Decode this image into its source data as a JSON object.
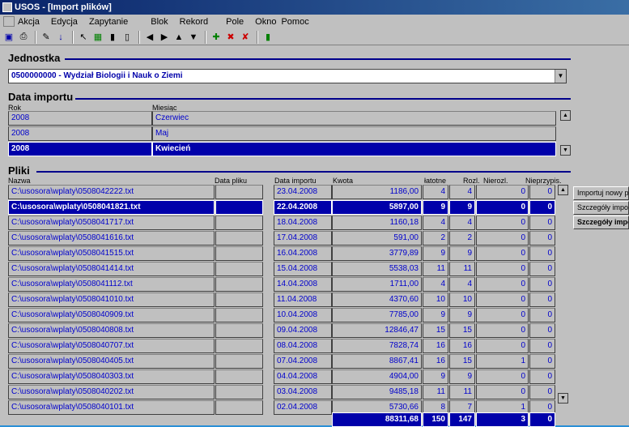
{
  "window": {
    "title": "USOS - [Import plików]"
  },
  "menu": [
    "Akcja",
    "Edycja",
    "Zapytanie",
    "Blok",
    "Rekord",
    "Pole",
    "Okno",
    "Pomoc"
  ],
  "toolbar": [
    {
      "name": "save-icon",
      "glyph": "▣",
      "color": "#0000aa"
    },
    {
      "name": "print-icon",
      "glyph": "⎙",
      "color": "#000000"
    },
    {
      "name": "edit-icon",
      "glyph": "✎",
      "color": "#000000"
    },
    {
      "name": "sort-down-icon",
      "glyph": "↓",
      "color": "#0000aa"
    },
    {
      "name": "query-icon",
      "glyph": "↖",
      "color": "#000000"
    },
    {
      "name": "query-execute-icon",
      "glyph": "▦",
      "color": "#008000"
    },
    {
      "name": "chart-icon",
      "glyph": "▮",
      "color": "#000000"
    },
    {
      "name": "chart-alt-icon",
      "glyph": "▯",
      "color": "#000000"
    },
    {
      "name": "prev-record-icon",
      "glyph": "◀",
      "color": "#000000"
    },
    {
      "name": "next-record-icon",
      "glyph": "▶",
      "color": "#000000"
    },
    {
      "name": "prev-block-icon",
      "glyph": "▲",
      "color": "#000000"
    },
    {
      "name": "next-block-icon",
      "glyph": "▼",
      "color": "#000000"
    },
    {
      "name": "insert-record-icon",
      "glyph": "✚",
      "color": "#008000"
    },
    {
      "name": "delete-record-icon",
      "glyph": "✖",
      "color": "#cc0000"
    },
    {
      "name": "clear-record-icon",
      "glyph": "✘",
      "color": "#cc0000"
    },
    {
      "name": "exit-icon",
      "glyph": "▮",
      "color": "#008000"
    }
  ],
  "jednostka": {
    "title": "Jednostka",
    "value": "0500000000 - Wydział Biologii i Nauk o Ziemi"
  },
  "data_importu": {
    "title": "Data importu",
    "col_rok": "Rok",
    "col_miesiac": "Miesiąc",
    "rows": [
      {
        "rok": "2008",
        "miesiac": "Czerwiec",
        "selected": false
      },
      {
        "rok": "2008",
        "miesiac": "Maj",
        "selected": false
      },
      {
        "rok": "2008",
        "miesiac": "Kwiecień",
        "selected": true
      }
    ]
  },
  "pliki": {
    "title": "Pliki",
    "headers": {
      "nazwa": "Nazwa",
      "data_pliku": "Data pliku",
      "data_importu": "Data importu",
      "kwota": "Kwota",
      "platne": "łatotne",
      "rozl": "Rozl.",
      "nierozl": "Nierozl.",
      "nieprzypis": "Nieprzypis."
    },
    "rows": [
      {
        "nazwa": "C:\\usosora\\wplaty\\0508042222.txt",
        "data_pliku": "",
        "data_importu": "23.04.2008",
        "kwota": "1186,00",
        "platne": "4",
        "rozl": "4",
        "nierozl": "0",
        "nieprzypis": "0",
        "selected": false
      },
      {
        "nazwa": "C:\\usosora\\wplaty\\0508041821.txt",
        "data_pliku": "",
        "data_importu": "22.04.2008",
        "kwota": "5897,00",
        "platne": "9",
        "rozl": "9",
        "nierozl": "0",
        "nieprzypis": "0",
        "selected": true
      },
      {
        "nazwa": "C:\\usosora\\wplaty\\0508041717.txt",
        "data_pliku": "",
        "data_importu": "18.04.2008",
        "kwota": "1160,18",
        "platne": "4",
        "rozl": "4",
        "nierozl": "0",
        "nieprzypis": "0",
        "selected": false
      },
      {
        "nazwa": "C:\\usosora\\wplaty\\0508041616.txt",
        "data_pliku": "",
        "data_importu": "17.04.2008",
        "kwota": "591,00",
        "platne": "2",
        "rozl": "2",
        "nierozl": "0",
        "nieprzypis": "0",
        "selected": false
      },
      {
        "nazwa": "C:\\usosora\\wplaty\\0508041515.txt",
        "data_pliku": "",
        "data_importu": "16.04.2008",
        "kwota": "3779,89",
        "platne": "9",
        "rozl": "9",
        "nierozl": "0",
        "nieprzypis": "0",
        "selected": false
      },
      {
        "nazwa": "C:\\usosora\\wplaty\\0508041414.txt",
        "data_pliku": "",
        "data_importu": "15.04.2008",
        "kwota": "5538,03",
        "platne": "11",
        "rozl": "11",
        "nierozl": "0",
        "nieprzypis": "0",
        "selected": false
      },
      {
        "nazwa": "C:\\usosora\\wplaty\\0508041112.txt",
        "data_pliku": "",
        "data_importu": "14.04.2008",
        "kwota": "1711,00",
        "platne": "4",
        "rozl": "4",
        "nierozl": "0",
        "nieprzypis": "0",
        "selected": false
      },
      {
        "nazwa": "C:\\usosora\\wplaty\\0508041010.txt",
        "data_pliku": "",
        "data_importu": "11.04.2008",
        "kwota": "4370,60",
        "platne": "10",
        "rozl": "10",
        "nierozl": "0",
        "nieprzypis": "0",
        "selected": false
      },
      {
        "nazwa": "C:\\usosora\\wplaty\\0508040909.txt",
        "data_pliku": "",
        "data_importu": "10.04.2008",
        "kwota": "7785,00",
        "platne": "9",
        "rozl": "9",
        "nierozl": "0",
        "nieprzypis": "0",
        "selected": false
      },
      {
        "nazwa": "C:\\usosora\\wplaty\\0508040808.txt",
        "data_pliku": "",
        "data_importu": "09.04.2008",
        "kwota": "12846,47",
        "platne": "15",
        "rozl": "15",
        "nierozl": "0",
        "nieprzypis": "0",
        "selected": false
      },
      {
        "nazwa": "C:\\usosora\\wplaty\\0508040707.txt",
        "data_pliku": "",
        "data_importu": "08.04.2008",
        "kwota": "7828,74",
        "platne": "16",
        "rozl": "16",
        "nierozl": "0",
        "nieprzypis": "0",
        "selected": false
      },
      {
        "nazwa": "C:\\usosora\\wplaty\\0508040405.txt",
        "data_pliku": "",
        "data_importu": "07.04.2008",
        "kwota": "8867,41",
        "platne": "16",
        "rozl": "15",
        "nierozl": "1",
        "nieprzypis": "0",
        "selected": false
      },
      {
        "nazwa": "C:\\usosora\\wplaty\\0508040303.txt",
        "data_pliku": "",
        "data_importu": "04.04.2008",
        "kwota": "4904,00",
        "platne": "9",
        "rozl": "9",
        "nierozl": "0",
        "nieprzypis": "0",
        "selected": false
      },
      {
        "nazwa": "C:\\usosora\\wplaty\\0508040202.txt",
        "data_pliku": "",
        "data_importu": "03.04.2008",
        "kwota": "9485,18",
        "platne": "11",
        "rozl": "11",
        "nierozl": "0",
        "nieprzypis": "0",
        "selected": false
      },
      {
        "nazwa": "C:\\usosora\\wplaty\\0508040101.txt",
        "data_pliku": "",
        "data_importu": "02.04.2008",
        "kwota": "5730,66",
        "platne": "8",
        "rozl": "7",
        "nierozl": "1",
        "nieprzypis": "0",
        "selected": false
      }
    ],
    "totals": {
      "kwota": "88311,68",
      "platne": "150",
      "rozl": "147",
      "nierozl": "3",
      "nieprzypis": "0"
    }
  },
  "side_buttons": [
    "Importuj nowy pli",
    "Szczegóły import",
    "Szczegóły impo"
  ]
}
